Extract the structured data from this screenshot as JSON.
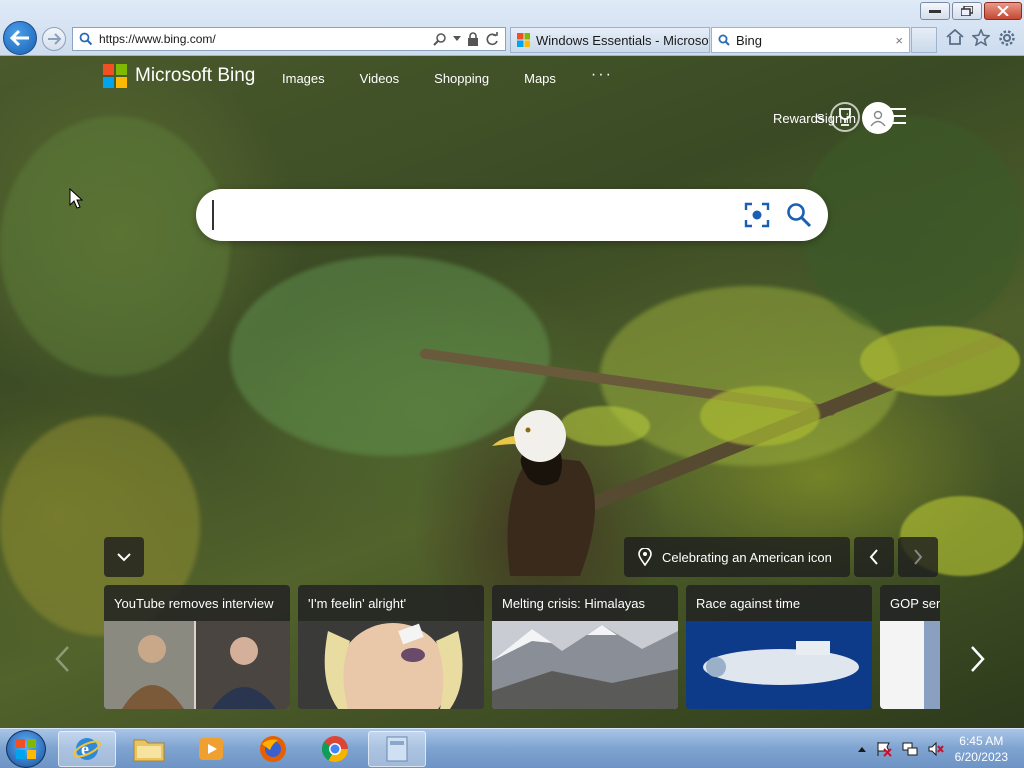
{
  "browser": {
    "address_url": "https://www.bing.com/",
    "tabs": [
      {
        "label": "Windows Essentials - Microsof..."
      },
      {
        "label": "Bing"
      }
    ],
    "tab_close": "×"
  },
  "bing": {
    "brand": "Microsoft Bing",
    "nav": [
      "Images",
      "Videos",
      "Shopping",
      "Maps"
    ],
    "nav_more": "···",
    "sign_in": "Sign in",
    "rewards": "Rewards",
    "search_placeholder": "",
    "image_caption": "Celebrating an American icon",
    "cards": [
      {
        "title": "YouTube removes interview"
      },
      {
        "title": "'I'm feelin' alright'"
      },
      {
        "title": "Melting crisis: Himalayas"
      },
      {
        "title": "Race against time"
      },
      {
        "title": "GOP sen"
      }
    ],
    "logo_colors": [
      "#f25022",
      "#7fba00",
      "#00a4ef",
      "#ffb900"
    ]
  },
  "taskbar": {
    "time": "6:45 AM",
    "date": "6/20/2023"
  }
}
